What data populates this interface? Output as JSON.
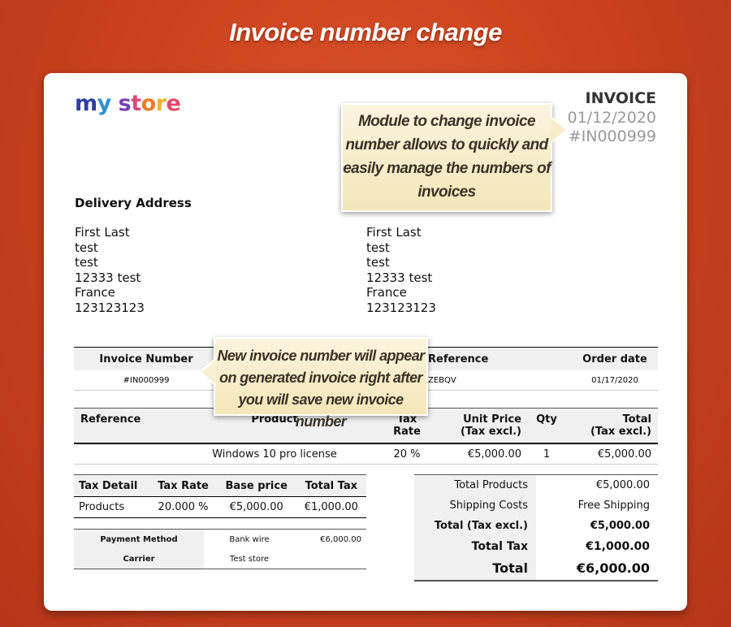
{
  "banner": "Invoice number change",
  "logo": {
    "text1": "my",
    "text2": "store"
  },
  "invoice": {
    "title": "INVOICE",
    "date": "01/12/2020",
    "number": "#IN000999"
  },
  "delivery_heading": "Delivery Address",
  "address_left": [
    "First Last",
    "test",
    "test",
    "12333 test",
    "France",
    "123123123"
  ],
  "address_right": [
    "First Last",
    "test",
    "test",
    "12333 test",
    "France",
    "123123123"
  ],
  "info_table": {
    "headers": [
      "Invoice Number",
      "",
      "Reference",
      "Order date"
    ],
    "values": [
      "#IN000999",
      "",
      "ZEBQV",
      "01/17/2020"
    ]
  },
  "product_table": {
    "headers": [
      "Reference",
      "Product",
      "Tax\nRate",
      "Unit Price\n(Tax excl.)",
      "Qty",
      "Total\n(Tax excl.)"
    ],
    "row": [
      "",
      "Windows 10 pro license",
      "20 %",
      "€5,000.00",
      "1",
      "€5,000.00"
    ]
  },
  "tax_table": {
    "headers": [
      "Tax Detail",
      "Tax Rate",
      "Base price",
      "Total Tax"
    ],
    "row": [
      "Products",
      "20.000 %",
      "€5,000.00",
      "€1,000.00"
    ]
  },
  "payment": {
    "method_label": "Payment Method",
    "method_value": "Bank wire",
    "method_amount": "€6,000.00",
    "carrier_label": "Carrier",
    "carrier_value": "Test store"
  },
  "totals": [
    {
      "label": "Total Products",
      "value": "€5,000.00"
    },
    {
      "label": "Shipping Costs",
      "value": "Free Shipping"
    },
    {
      "label": "Total (Tax excl.)",
      "value": "€5,000.00"
    },
    {
      "label": "Total Tax",
      "value": "€1,000.00"
    },
    {
      "label": "Total",
      "value": "€6,000.00"
    }
  ],
  "callouts": {
    "one": [
      "Module to change invoice",
      "number allows to quickly and",
      "easily manage the numbers of",
      "invoices"
    ],
    "two": [
      "New invoice number will appear",
      "on generated invoice  right after",
      "you will save new invoice number"
    ]
  },
  "colors": {
    "background": "#c8401c",
    "callout": "#f3e6b8"
  }
}
